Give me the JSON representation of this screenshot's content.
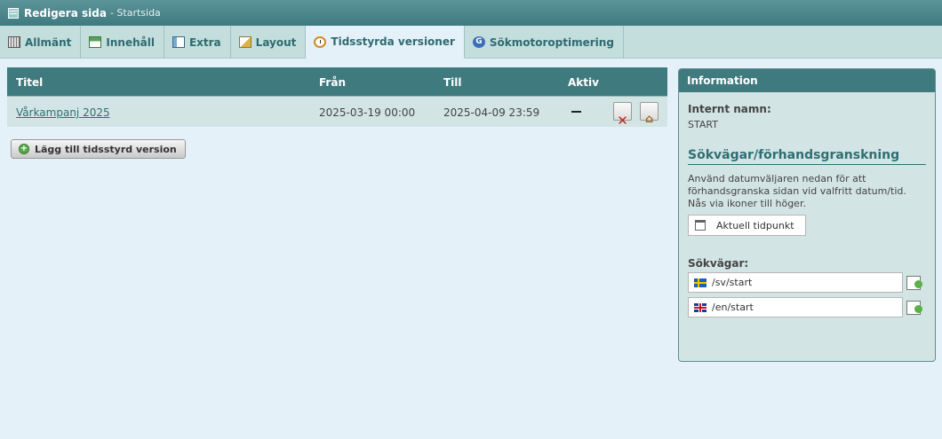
{
  "titlebar": {
    "title": "Redigera sida",
    "subtitle": "- Startsida"
  },
  "tabs": [
    {
      "label": "Allmänt",
      "icon": "keyboard-icon"
    },
    {
      "label": "Innehåll",
      "icon": "content-icon"
    },
    {
      "label": "Extra",
      "icon": "extra-icon"
    },
    {
      "label": "Layout",
      "icon": "layout-icon"
    },
    {
      "label": "Tidsstyrda versioner",
      "icon": "clock-icon",
      "active": true
    },
    {
      "label": "Sökmotoroptimering",
      "icon": "google-icon"
    }
  ],
  "table": {
    "headers": {
      "title": "Titel",
      "from": "Från",
      "to": "Till",
      "active": "Aktiv"
    },
    "rows": [
      {
        "title": "Vårkampanj 2025",
        "from": "2025-03-19 00:00",
        "to": "2025-04-09 23:59",
        "active": "—"
      }
    ]
  },
  "add_button": "Lägg till tidsstyrd version",
  "info": {
    "header": "Information",
    "internal_name_label": "Internt namn:",
    "internal_name_value": "START",
    "paths_title": "Sökvägar/förhandsgranskning",
    "description": "Använd datumväljaren nedan för att förhandsgranska sidan vid valfritt datum/tid. Nås via ikoner till höger.",
    "date_button": "Aktuell tidpunkt",
    "paths_label": "Sökvägar:",
    "paths": [
      {
        "flag": "sweden-flag-icon",
        "value": "/sv/start"
      },
      {
        "flag": "uk-flag-icon",
        "value": "/en/start"
      }
    ]
  },
  "colors": {
    "header": "#3f7a7f",
    "background": "#e4f1f8",
    "accent_text": "#2f6f74"
  }
}
